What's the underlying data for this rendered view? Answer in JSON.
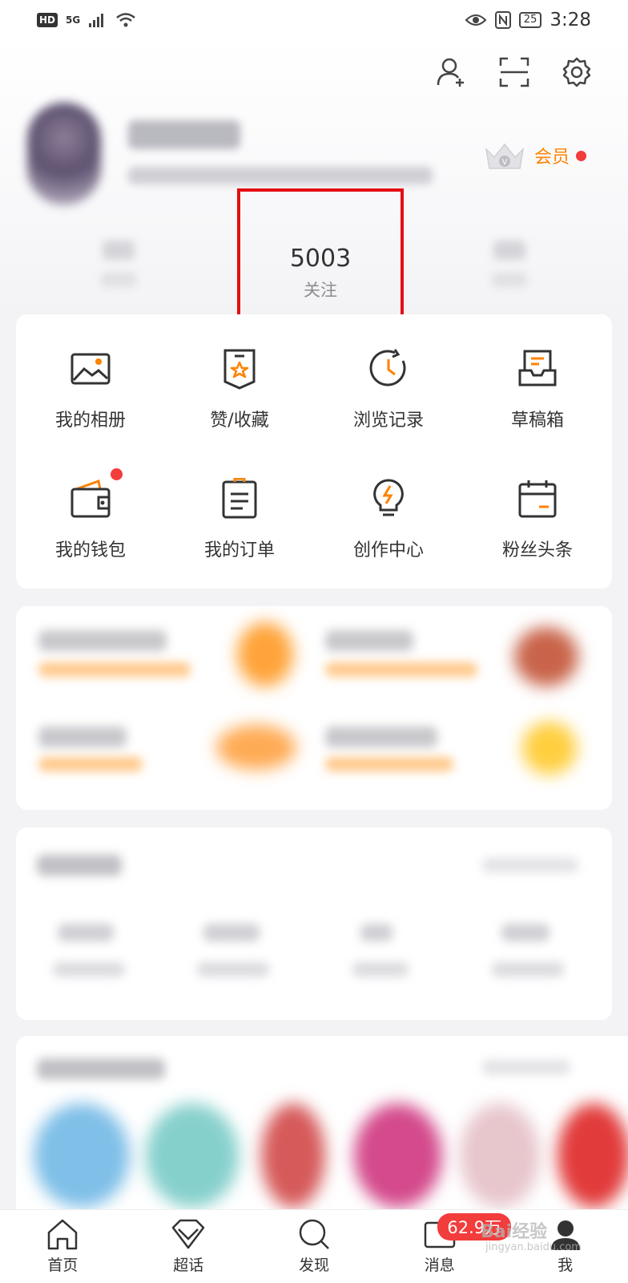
{
  "status_bar": {
    "hd": "HD",
    "network": "5G",
    "battery": "25",
    "time": "3:28"
  },
  "header": {
    "vip_label": "会员"
  },
  "stats": {
    "follow_count": "5003",
    "follow_label": "关注"
  },
  "grid": {
    "items": [
      {
        "label": "我的相册",
        "icon": "album-icon"
      },
      {
        "label": "赞/收藏",
        "icon": "favorite-icon"
      },
      {
        "label": "浏览记录",
        "icon": "history-icon"
      },
      {
        "label": "草稿箱",
        "icon": "drafts-icon"
      },
      {
        "label": "我的钱包",
        "icon": "wallet-icon"
      },
      {
        "label": "我的订单",
        "icon": "orders-icon"
      },
      {
        "label": "创作中心",
        "icon": "creator-icon"
      },
      {
        "label": "粉丝头条",
        "icon": "calendar-icon"
      }
    ]
  },
  "tabs": [
    {
      "label": "首页",
      "icon": "home-icon"
    },
    {
      "label": "超话",
      "icon": "diamond-icon"
    },
    {
      "label": "发现",
      "icon": "search-icon"
    },
    {
      "label": "消息",
      "icon": "message-icon",
      "badge": "62.9万"
    },
    {
      "label": "我",
      "icon": "profile-icon"
    }
  ],
  "watermark": {
    "text": "Bai经验",
    "sub": "jingyan.baidu.com"
  },
  "colors": {
    "accent": "#ff8200",
    "badge": "#f33c3c",
    "highlight": "#e40e12"
  }
}
